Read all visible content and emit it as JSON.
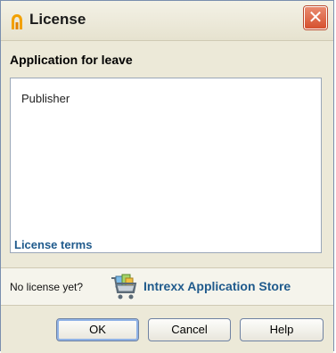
{
  "window": {
    "title": "License",
    "close_label": "✕"
  },
  "header": {
    "app_title": "Application for leave"
  },
  "content": {
    "publisher": "Publisher"
  },
  "links": {
    "license_terms": "License terms"
  },
  "license_row": {
    "no_license_text": "No license yet?",
    "store_label": "Intrexx Application Store"
  },
  "buttons": {
    "ok": "OK",
    "cancel": "Cancel",
    "help": "Help"
  },
  "colors": {
    "link": "#1f5a8c",
    "close_button": "#d6502f",
    "title_icon": "#f2a100"
  }
}
